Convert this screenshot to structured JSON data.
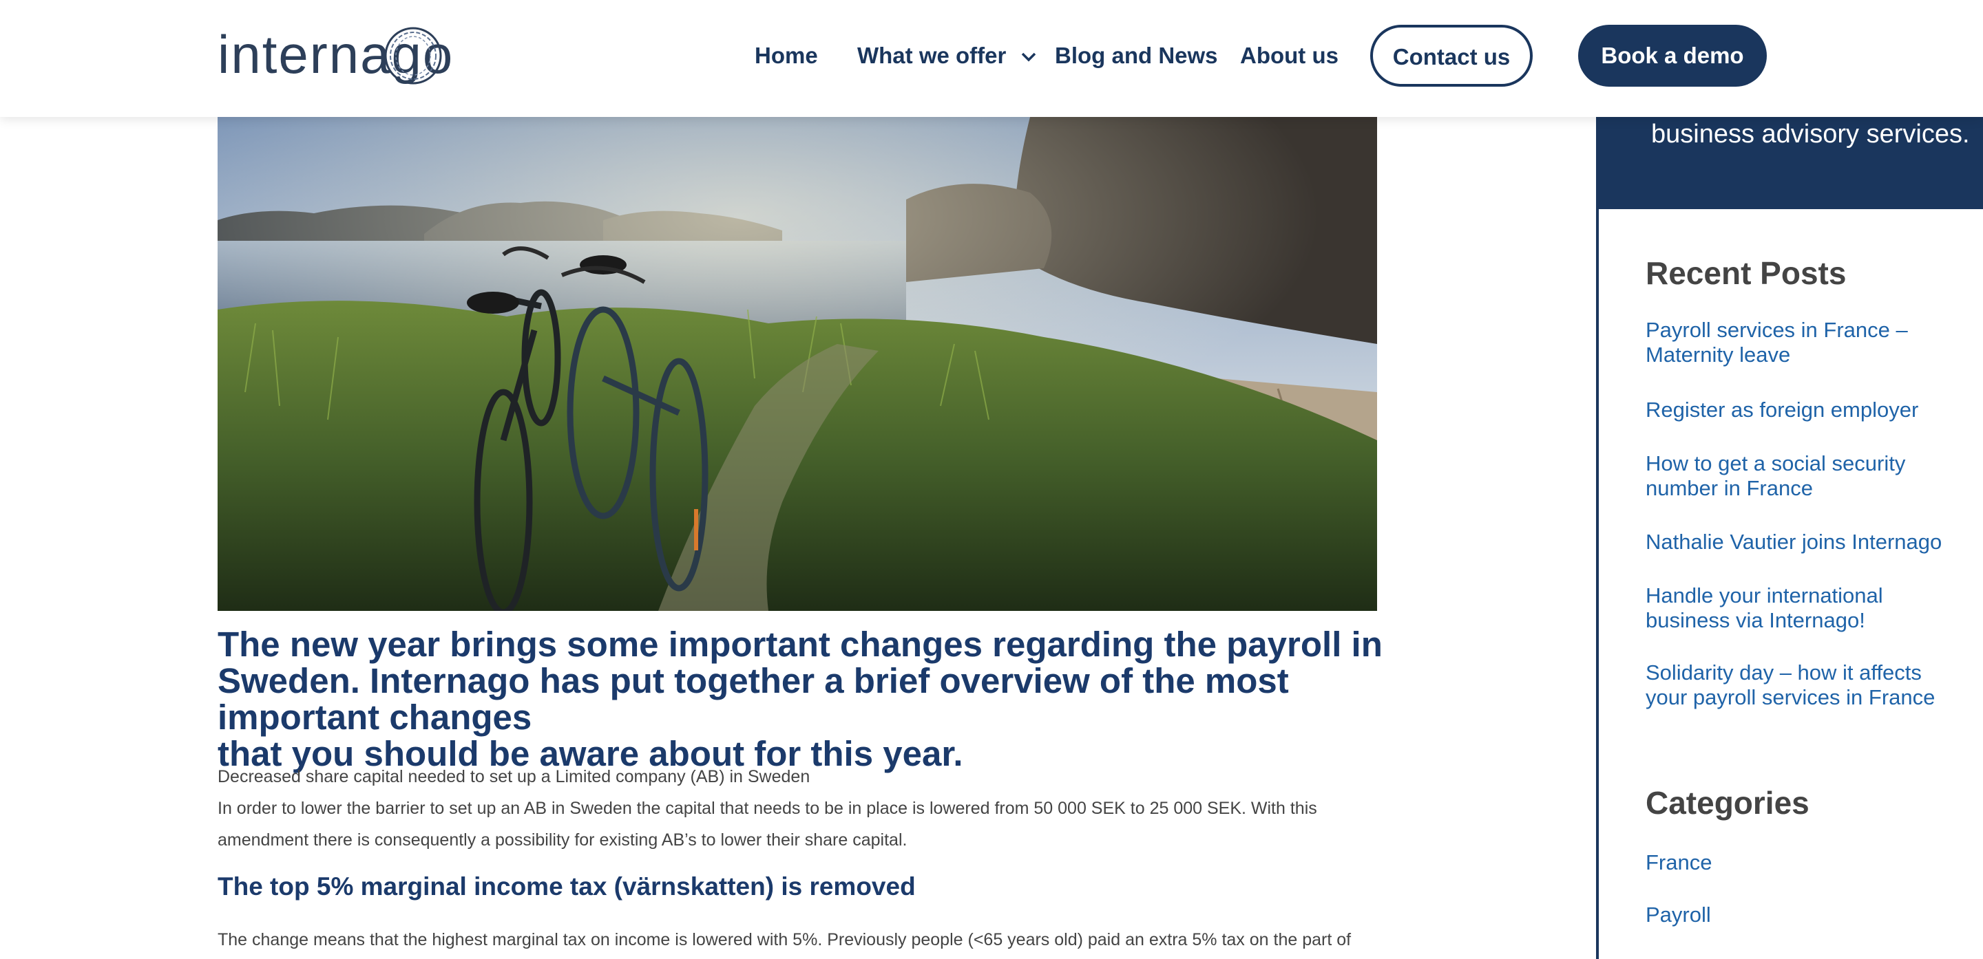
{
  "header": {
    "logo_text": "internago",
    "nav": [
      {
        "label": "Home"
      },
      {
        "label": "What we offer"
      },
      {
        "label": "Blog and News"
      },
      {
        "label": "About us"
      }
    ],
    "contact_label": "Contact us",
    "demo_label": "Book a demo"
  },
  "hero": {
    "icon": "photo-bicycles-by-lake"
  },
  "article": {
    "title_line1": "The new year brings some important changes regarding the payroll in",
    "title_line2": "Sweden. Internago has put together a brief overview of  the most important changes",
    "title_line3": "that you should be aware about for this year.",
    "p1": "Decreased share capital needed to set up a Limited company (AB) in Sweden",
    "p2": "In order to lower the barrier to set up an AB in Sweden the capital that needs to be in place is lowered from 50 000 SEK to 25 000 SEK. With this",
    "p3": "amendment there is consequently a possibility for existing AB’s to lower their share capital.",
    "h2": "The top 5% marginal income tax (värnskatten) is removed",
    "p4": "The change means that the highest marginal tax on income is lowered with 5%. Previously people (<65 years old) paid an extra 5% tax on the part of"
  },
  "sidebar": {
    "promo_text": "business advisory services.",
    "recent_heading": "Recent Posts",
    "recent": [
      {
        "line1": "Payroll services in France –",
        "line2": "Maternity leave"
      },
      {
        "line1": "Register as foreign employer",
        "line2": ""
      },
      {
        "line1": "How to get a social security",
        "line2": "number in France"
      },
      {
        "line1": "Nathalie Vautier joins Internago",
        "line2": ""
      },
      {
        "line1": "Handle your international",
        "line2": "business via Internago!"
      },
      {
        "line1": "Solidarity day – how it affects",
        "line2": "your payroll services in France"
      }
    ],
    "categories_heading": "Categories",
    "categories": [
      "France",
      "Payroll"
    ]
  },
  "colors": {
    "brand_navy": "#1a365d",
    "heading_blue": "#1b3a6b",
    "link_blue": "#1f63a8"
  }
}
